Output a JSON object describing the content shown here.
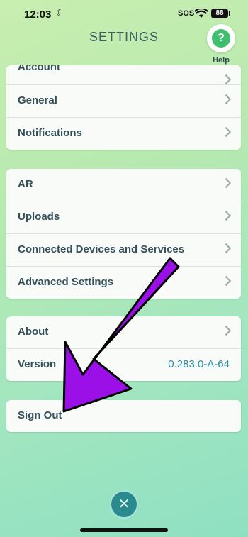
{
  "status": {
    "time": "12:03",
    "sos": "SOS",
    "battery": "88"
  },
  "header": {
    "title": "SETTINGS",
    "help_label": "Help",
    "help_glyph": "?"
  },
  "sections": {
    "account": {
      "items": [
        {
          "label": "Account"
        },
        {
          "label": "General"
        },
        {
          "label": "Notifications"
        }
      ]
    },
    "devices": {
      "items": [
        {
          "label": "AR"
        },
        {
          "label": "Uploads"
        },
        {
          "label": "Connected Devices and Services"
        },
        {
          "label": "Advanced Settings"
        }
      ]
    },
    "info": {
      "items": [
        {
          "label": "About"
        },
        {
          "label": "Version",
          "value": "0.283.0-A-64"
        }
      ]
    },
    "signout": {
      "label": "Sign Out"
    }
  },
  "footer": {
    "close_glyph": "✕"
  },
  "annotation": {
    "arrow_color": "#9b10e6",
    "arrow_outline": "#000000"
  }
}
